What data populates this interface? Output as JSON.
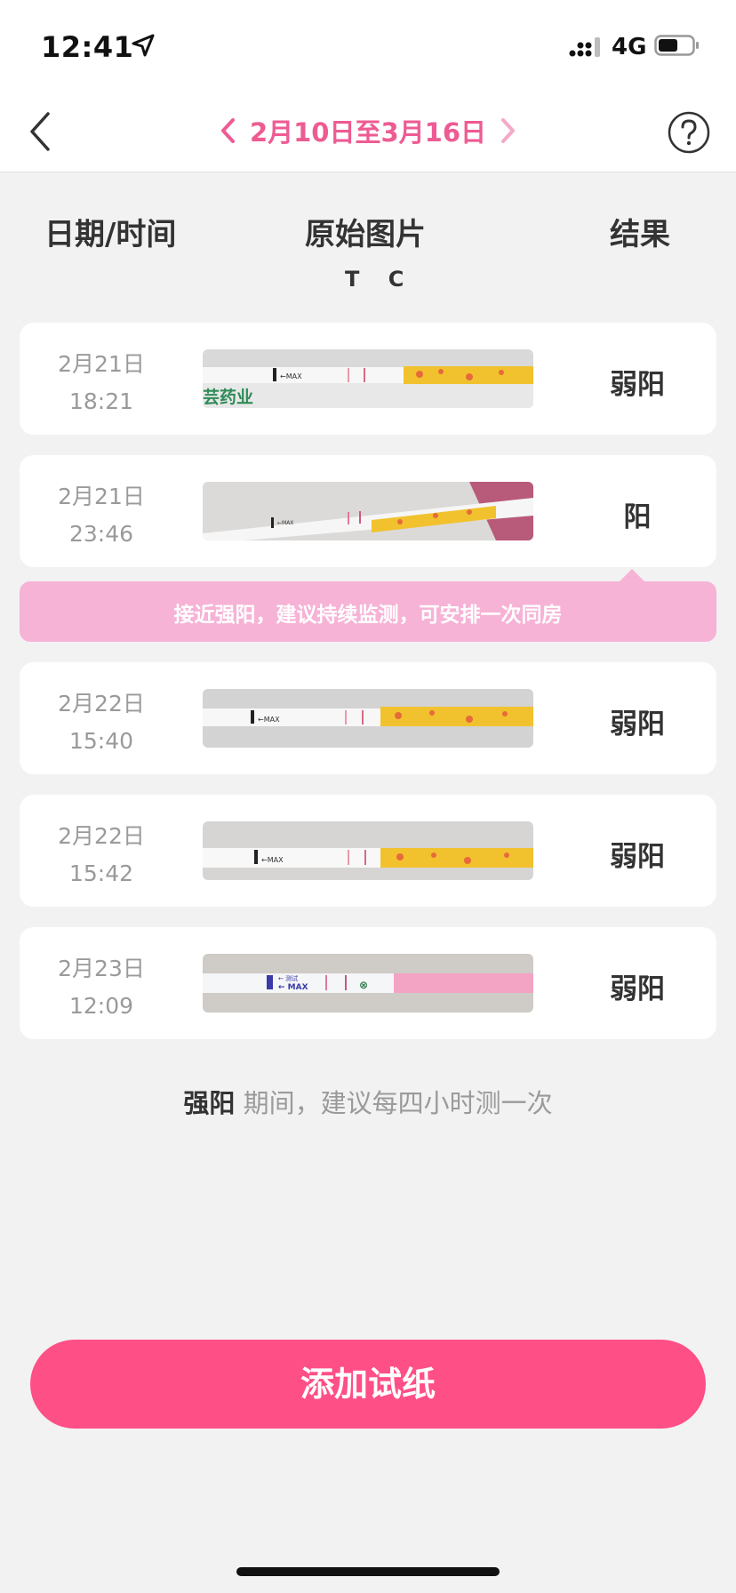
{
  "status_bar": {
    "time": "12:41",
    "network": "4G",
    "icons": [
      "location-arrow-icon",
      "signal-icon",
      "battery-icon"
    ]
  },
  "nav": {
    "date_range": "2月10日至3月16日",
    "icons": [
      "back-chevron-icon",
      "prev-arrow-icon",
      "next-arrow-icon",
      "help-icon"
    ]
  },
  "colors": {
    "accent": "#ff4f87",
    "title_pink": "#ee5b93",
    "tip_bg": "#f6b3d6",
    "background": "#f2f2f2"
  },
  "header": {
    "date_time": "日期/时间",
    "original_image": "原始图片",
    "result": "结果",
    "tc": "T C"
  },
  "records": [
    {
      "date": "2月21日",
      "time": "18:21",
      "result": "弱阳",
      "strip_brand_text": "芸药业"
    },
    {
      "date": "2月21日",
      "time": "23:46",
      "result": "阳"
    },
    {
      "date": "2月22日",
      "time": "15:40",
      "result": "弱阳"
    },
    {
      "date": "2月22日",
      "time": "15:42",
      "result": "弱阳"
    },
    {
      "date": "2月23日",
      "time": "12:09",
      "result": "弱阳"
    }
  ],
  "tooltip": "接近强阳，建议持续监测，可安排一次同房",
  "advice": {
    "bold": "强阳",
    "rest": " 期间，建议每四小时测一次"
  },
  "add_button": "添加试纸"
}
